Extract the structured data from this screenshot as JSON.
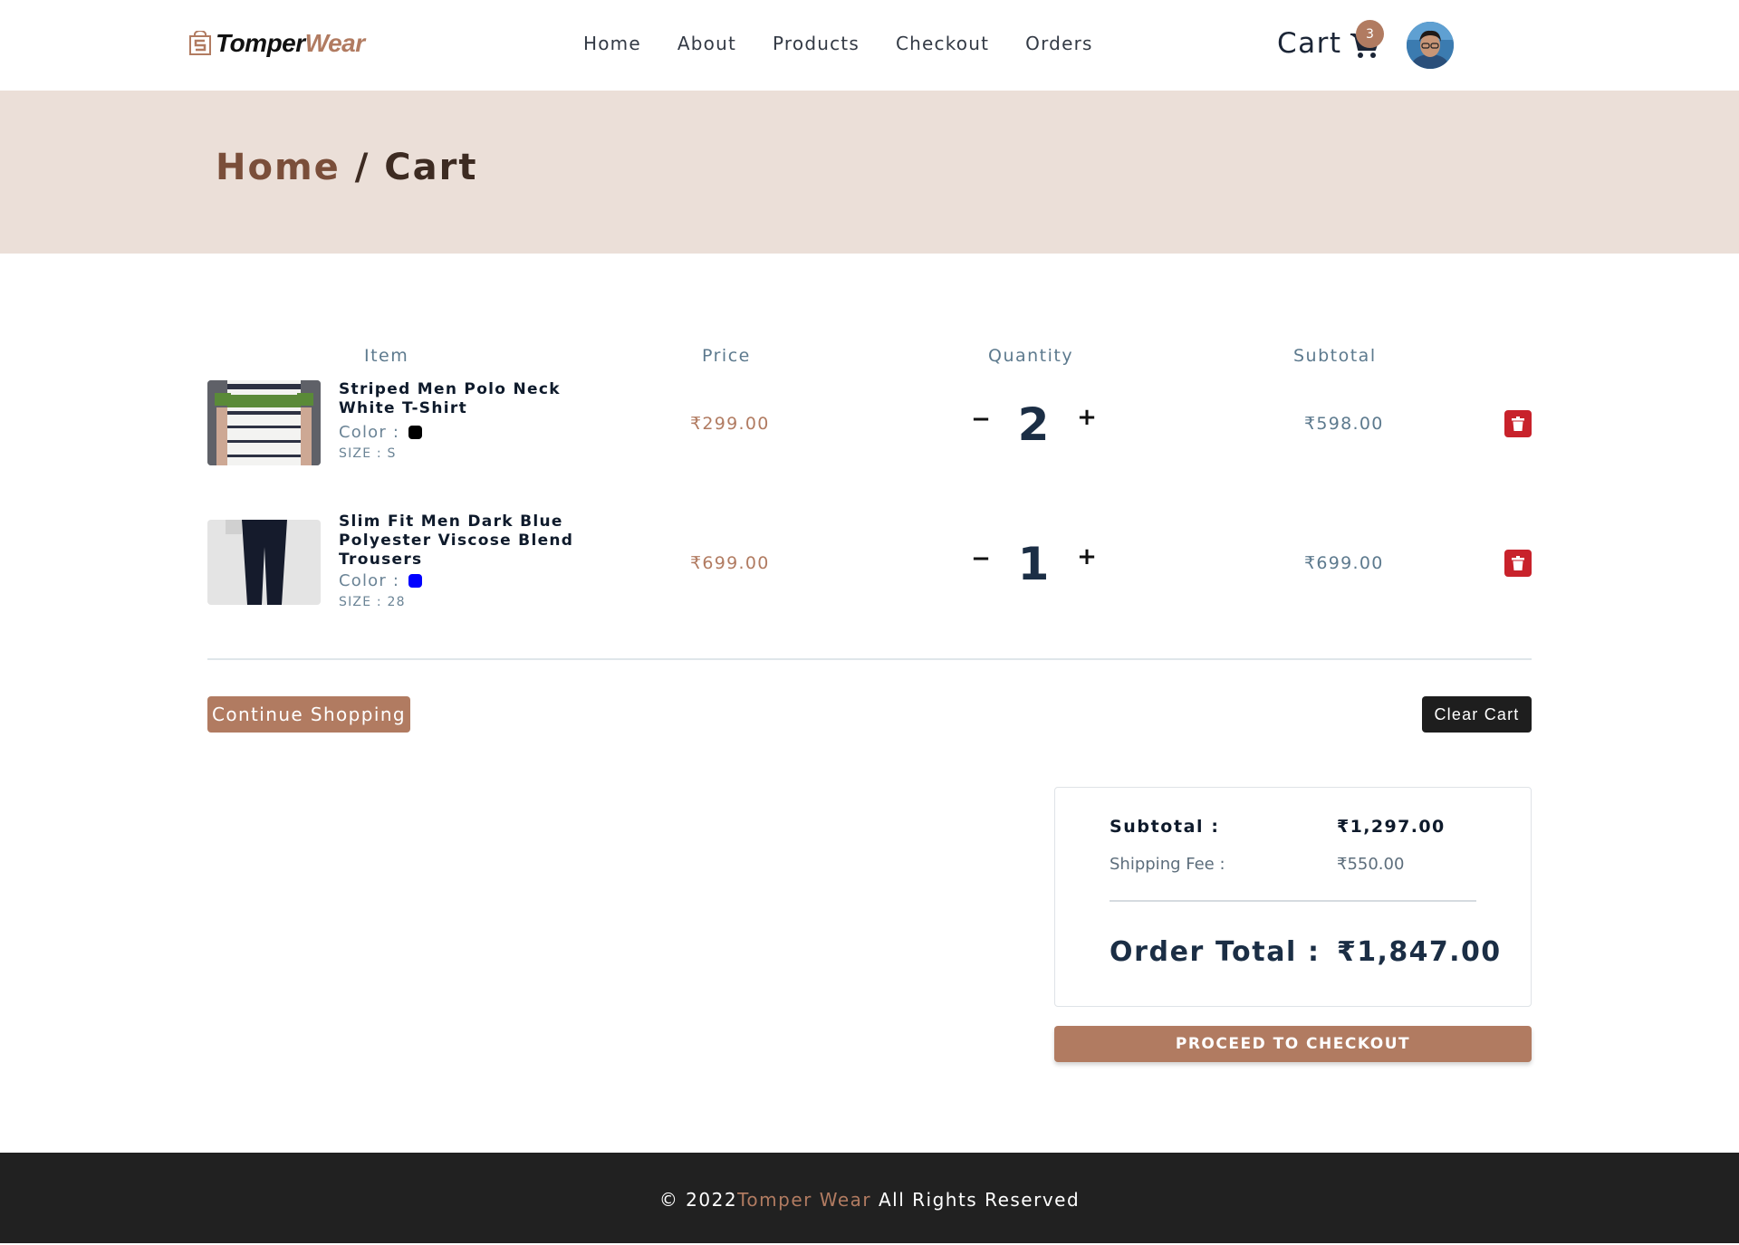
{
  "brand": {
    "name_part1": "Tomper",
    "name_part2": "Wear"
  },
  "nav": {
    "items": [
      "Home",
      "About",
      "Products",
      "Checkout",
      "Orders"
    ]
  },
  "cart": {
    "label": "Cart",
    "count": "3"
  },
  "breadcrumb": {
    "home": "Home",
    "separator": "/",
    "current": "Cart"
  },
  "table": {
    "headers": {
      "item": "Item",
      "price": "Price",
      "quantity": "Quantity",
      "subtotal": "Subtotal"
    },
    "color_label": "Color :",
    "rows": [
      {
        "name": "Striped Men Polo Neck White T-Shirt",
        "color": "#000000",
        "size": "SIZE : S",
        "price": "₹299.00",
        "quantity": "2",
        "subtotal": "₹598.00"
      },
      {
        "name": "Slim Fit Men Dark Blue Polyester Viscose Blend Trousers",
        "color": "#0000ff",
        "size": "SIZE : 28",
        "price": "₹699.00",
        "quantity": "1",
        "subtotal": "₹699.00"
      }
    ]
  },
  "actions": {
    "continue": "Continue Shopping",
    "clear": "Clear Cart"
  },
  "totals": {
    "subtotal_label": "Subtotal :",
    "subtotal_value": "₹1,297.00",
    "shipping_label": "Shipping Fee :",
    "shipping_value": "₹550.00",
    "order_total_label": "Order Total :",
    "order_total_value": "₹1,847.00"
  },
  "checkout_button": "PROCEED TO CHECKOUT",
  "footer": {
    "prefix": "© 2022",
    "brand": "Tomper Wear",
    "suffix": "All Rights Reserved"
  },
  "colors": {
    "accent": "#b17b61",
    "band": "#ebdfd8",
    "dark": "#212121",
    "delete": "#c8222b"
  }
}
